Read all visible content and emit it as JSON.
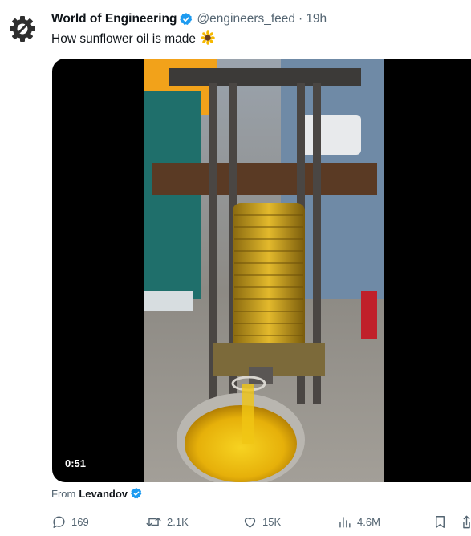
{
  "author": {
    "name": "World of Engineering",
    "handle": "@engineers_feed",
    "separator": "·",
    "time": "19h"
  },
  "tweet": {
    "text": "How sunflower oil is made",
    "emoji_icon": "sunflower-icon"
  },
  "media": {
    "duration": "0:51"
  },
  "source": {
    "prefix": "From",
    "name": "Levandov"
  },
  "actions": {
    "replies": "169",
    "reposts": "2.1K",
    "likes": "15K",
    "views": "4.6M",
    "bookmark_icon": "bookmark-icon",
    "share_icon": "share-icon"
  },
  "colors": {
    "verified": "#1d9bf0",
    "muted": "#536471",
    "text": "#0f1419"
  }
}
